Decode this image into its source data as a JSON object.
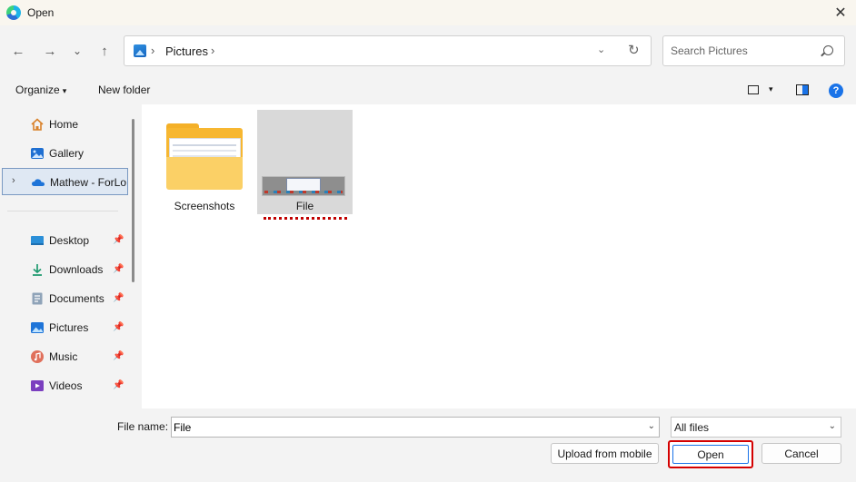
{
  "window": {
    "title": "Open",
    "close_glyph": "✕",
    "app_icon": "edge-icon"
  },
  "navigation": {
    "back_glyph": "←",
    "forward_glyph": "→",
    "recent_glyph": "⌄",
    "up_glyph": "↑",
    "address": {
      "icon": "pictures-icon",
      "separator": "›",
      "segments": [
        "Pictures"
      ]
    },
    "dropdown_glyph": "⌄",
    "refresh_glyph": "↻",
    "search_placeholder": "Search Pictures"
  },
  "command_bar": {
    "organize_label": "Organize",
    "new_folder_label": "New folder",
    "caret": "▾",
    "help_label": "?"
  },
  "sidebar": {
    "items": [
      {
        "label": "Home",
        "icon": "home-icon",
        "pinned": false
      },
      {
        "label": "Gallery",
        "icon": "gallery-icon",
        "pinned": false
      },
      {
        "label": "Mathew - ForLo",
        "icon": "onedrive-cloud-icon",
        "pinned": false,
        "selected": true,
        "expander": "›"
      },
      {
        "label": "Desktop",
        "icon": "desktop-icon",
        "pinned": true
      },
      {
        "label": "Downloads",
        "icon": "download-icon",
        "pinned": true
      },
      {
        "label": "Documents",
        "icon": "documents-icon",
        "pinned": true
      },
      {
        "label": "Pictures",
        "icon": "pictures-icon",
        "pinned": true
      },
      {
        "label": "Music",
        "icon": "music-icon",
        "pinned": true
      },
      {
        "label": "Videos",
        "icon": "videos-icon",
        "pinned": true
      }
    ],
    "pin_glyph": "📌"
  },
  "files": [
    {
      "name": "Screenshots",
      "kind": "folder",
      "selected": false
    },
    {
      "name": "File",
      "kind": "image",
      "selected": true
    }
  ],
  "footer": {
    "file_name_label": "File name:",
    "file_name_value": "File",
    "file_type_value": "All files",
    "caret": "⌄",
    "upload_label": "Upload from mobile",
    "open_label": "Open",
    "cancel_label": "Cancel"
  },
  "colors": {
    "accent": "#1a73e8",
    "highlight_box": "#d40000",
    "folder": "#f7b731"
  }
}
